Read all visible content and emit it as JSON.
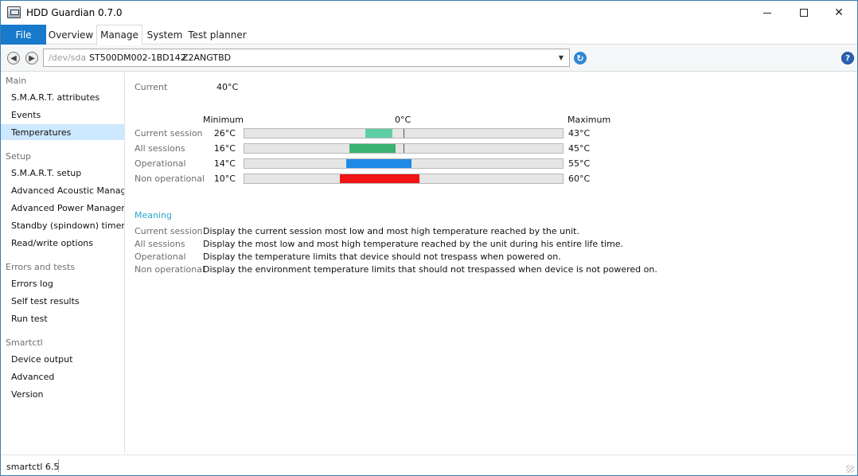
{
  "window": {
    "title": "HDD Guardian 0.7.0"
  },
  "tabs": {
    "file": "File",
    "items": [
      "Overview",
      "Manage",
      "System",
      "Test planner"
    ],
    "active": "Manage"
  },
  "address": {
    "device": "/dev/sda",
    "model": "ST500DM002-1BD142",
    "serial": "Z2ANGTBD"
  },
  "sidebar": {
    "groups": [
      {
        "header": "Main",
        "items": [
          "S.M.A.R.T. attributes",
          "Events",
          "Temperatures"
        ]
      },
      {
        "header": "Setup",
        "items": [
          "S.M.A.R.T. setup",
          "Advanced Acoustic Management",
          "Advanced Power Management",
          "Standby (spindown) timer",
          "Read/write options"
        ]
      },
      {
        "header": "Errors and tests",
        "items": [
          "Errors log",
          "Self test results",
          "Run test"
        ]
      },
      {
        "header": "Smartctl",
        "items": [
          "Device output",
          "Advanced",
          "Version"
        ]
      }
    ],
    "selected": "Temperatures"
  },
  "temperatures": {
    "current_label": "Current",
    "current_value": "40°C",
    "header_min": "Minimum",
    "header_zero": "0°C",
    "header_max": "Maximum",
    "scale_min": -50,
    "scale_max": 150,
    "rows": [
      {
        "label": "Current session",
        "min": "26°C",
        "max": "43°C",
        "min_value": 26,
        "max_value": 43,
        "color": "#5ecfa5"
      },
      {
        "label": "All sessions",
        "min": "16°C",
        "max": "45°C",
        "min_value": 16,
        "max_value": 45,
        "color": "#3bb272"
      },
      {
        "label": "Operational",
        "min": "14°C",
        "max": "55°C",
        "min_value": 14,
        "max_value": 55,
        "color": "#1e8ae6"
      },
      {
        "label": "Non operational",
        "min": "10°C",
        "max": "60°C",
        "min_value": 10,
        "max_value": 60,
        "color": "#f01414"
      }
    ]
  },
  "meaning": {
    "title": "Meaning",
    "rows": [
      {
        "label": "Current session",
        "text": "Display the current session most low and most high temperature reached by the unit."
      },
      {
        "label": "All sessions",
        "text": "Display the most low and most high temperature reached by the unit during his entire life time."
      },
      {
        "label": "Operational",
        "text": "Display the temperature limits that device should not trespass when powered on."
      },
      {
        "label": "Non operational",
        "text": "Display the environment temperature limits that should not trespassed when device is not powered on."
      }
    ]
  },
  "status": {
    "text": "smartctl 6.5"
  }
}
